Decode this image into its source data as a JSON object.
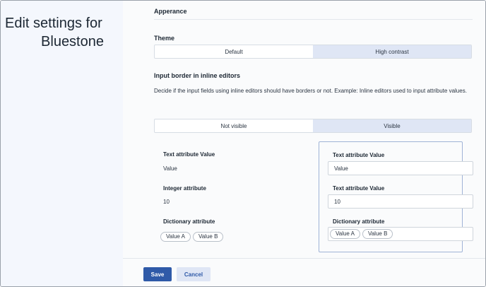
{
  "sidebar": {
    "title_line1": "Edit settings for",
    "title_line2": "Bluestone"
  },
  "appearance": {
    "heading": "Apperance"
  },
  "theme": {
    "label": "Theme",
    "options": [
      "Default",
      "High contrast"
    ],
    "selected": "High contrast"
  },
  "input_border": {
    "label": "Input border in inline editors",
    "description": "Decide if the input fields using inline editors should have borders or not. Example: Inline editors used to input attribute values.",
    "options": [
      "Not visible",
      "Visible"
    ],
    "selected": "Visible"
  },
  "preview_plain": {
    "text_label": "Text attribute Value",
    "text_value": "Value",
    "integer_label": "Integer attribute",
    "integer_value": "10",
    "dictionary_label": "Dictionary attribute",
    "chips": [
      "Value A",
      "Value B"
    ]
  },
  "preview_bordered": {
    "text_label": "Text attribute Value",
    "text_value": "Value",
    "second_label": "Text attribute Value",
    "second_value": "10",
    "dictionary_label": "Dictionary attribute",
    "chips": [
      "Value A",
      "Value B"
    ]
  },
  "footer": {
    "save_label": "Save",
    "cancel_label": "Cancel"
  },
  "colors": {
    "primary": "#2f5aa8",
    "selected_option": "#dfe6f5",
    "sidebar_bg": "#f4f7fd"
  }
}
